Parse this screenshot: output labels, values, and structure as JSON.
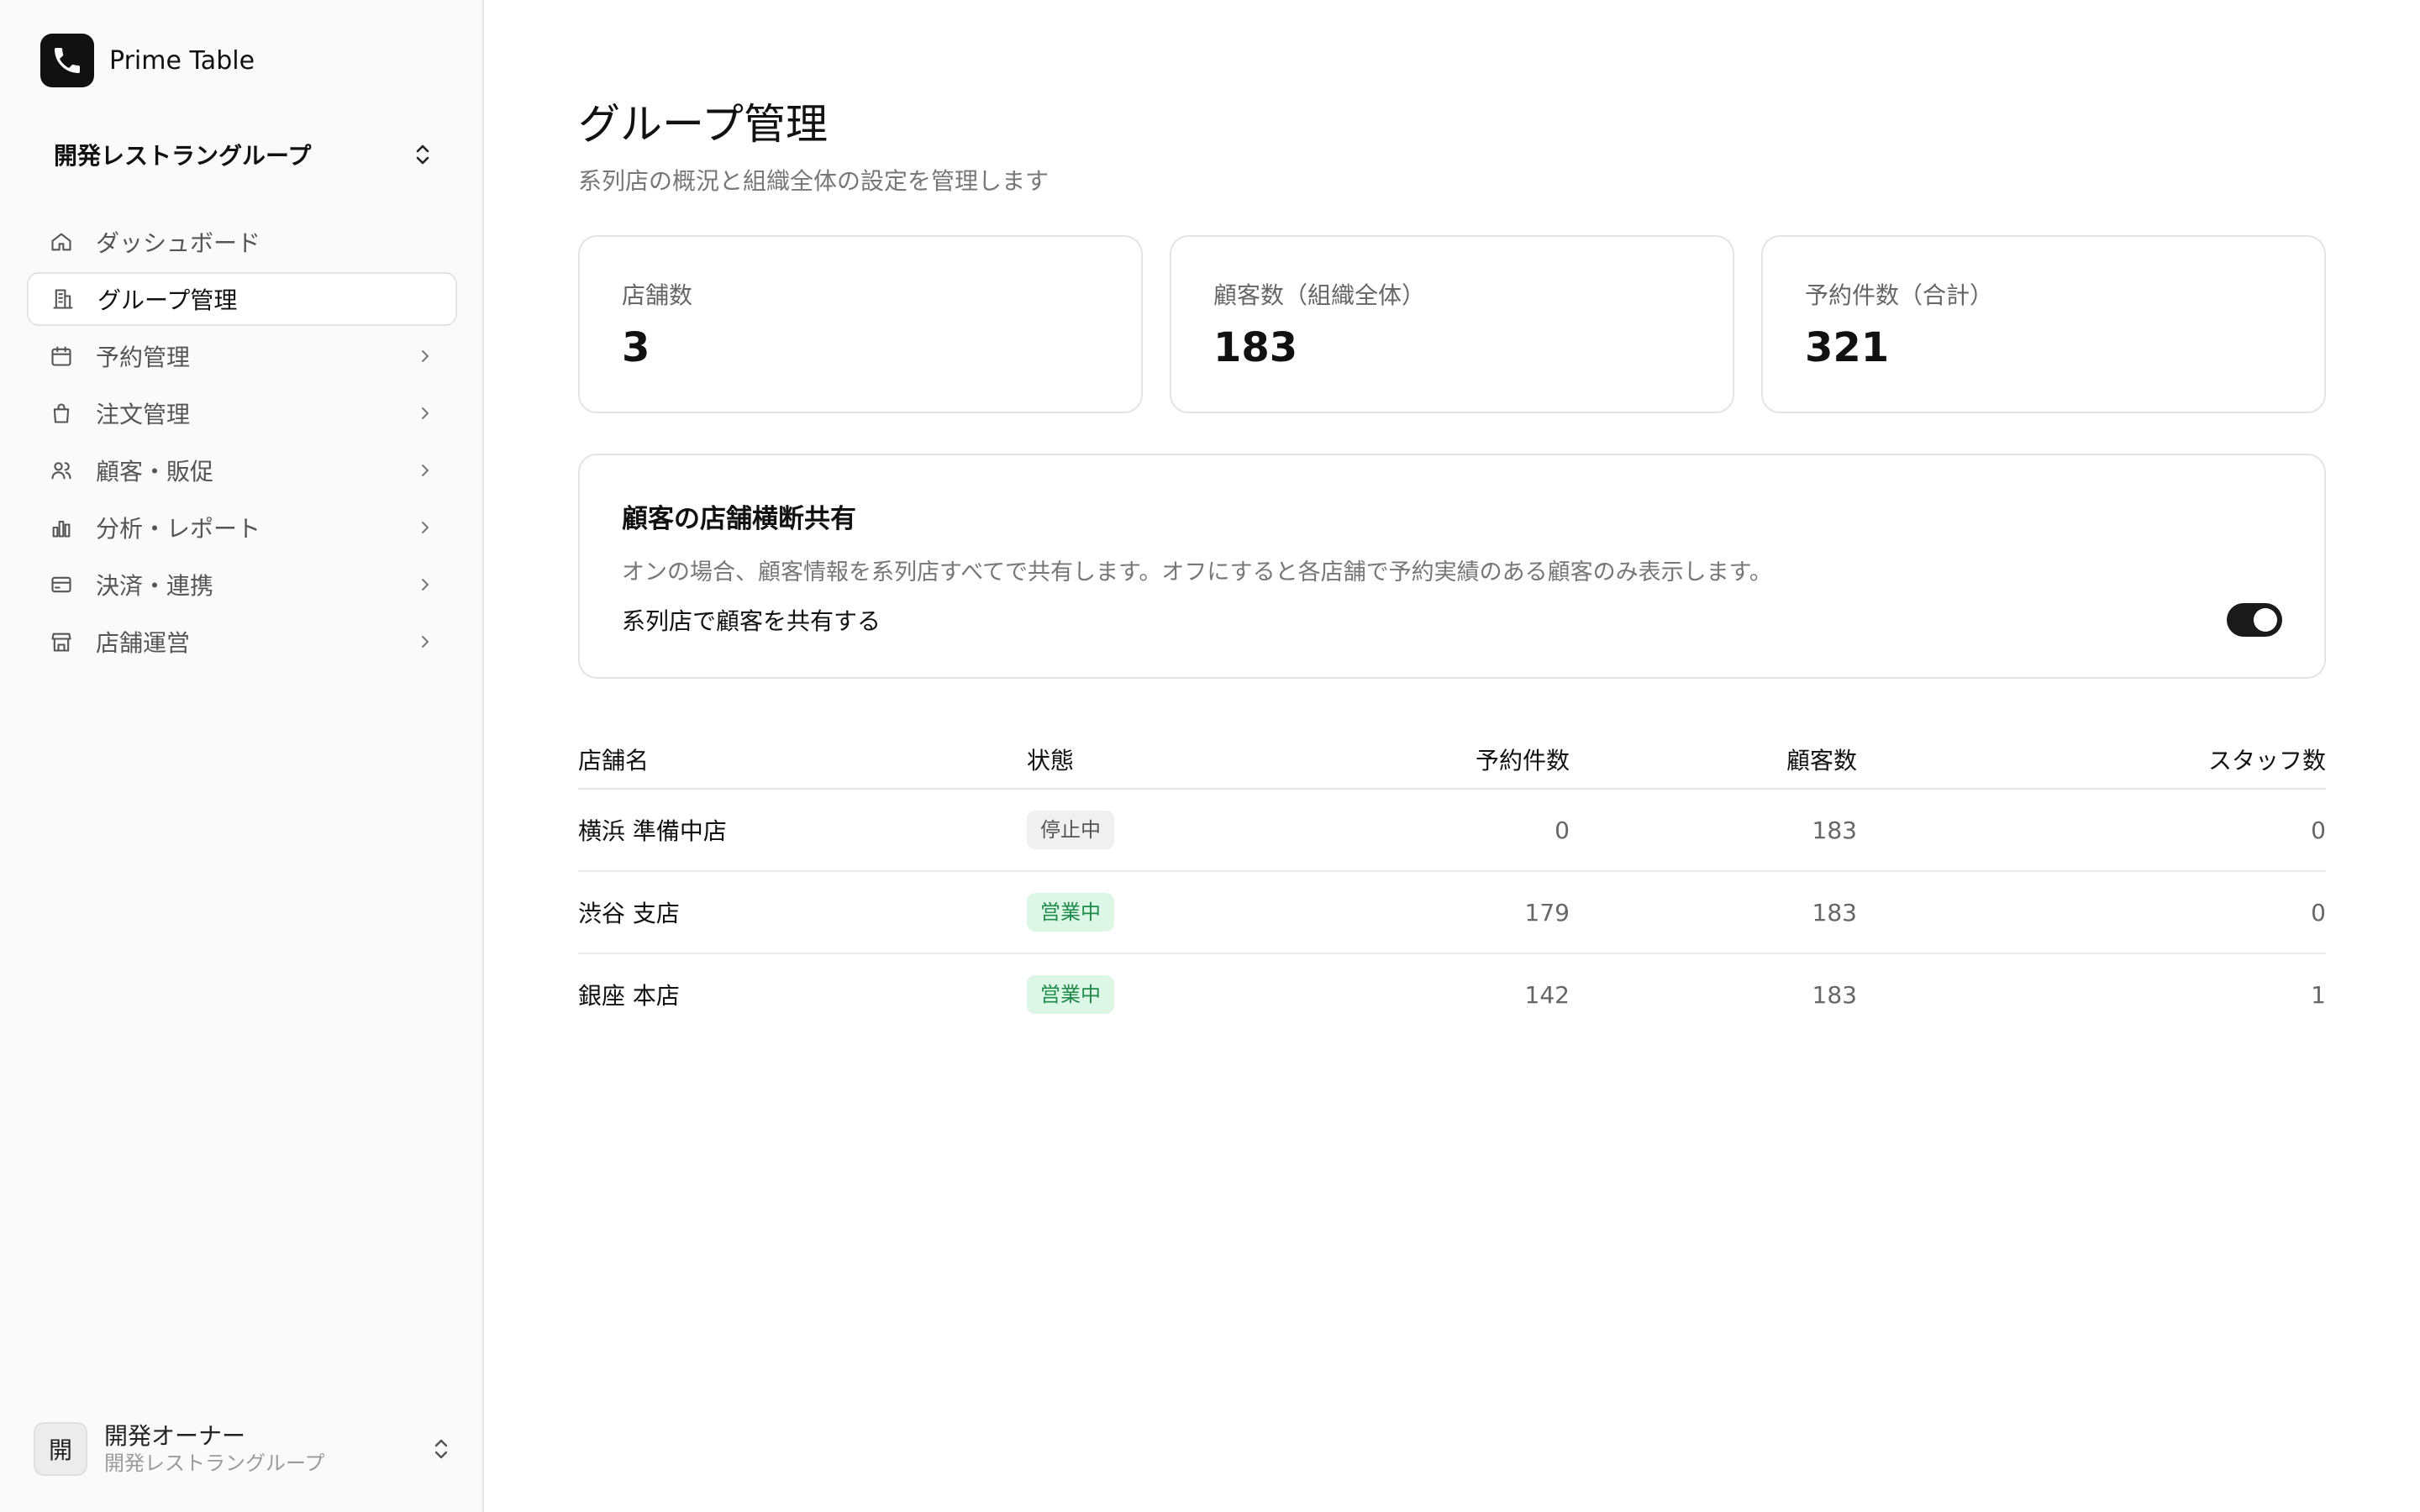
{
  "app": {
    "name": "Prime Table"
  },
  "org_switcher": {
    "name": "開発レストラングループ"
  },
  "nav": [
    {
      "label": "ダッシュボード",
      "icon": "home-icon",
      "active": false,
      "chevron": false
    },
    {
      "label": "グループ管理",
      "icon": "building-icon",
      "active": true,
      "chevron": false
    },
    {
      "label": "予約管理",
      "icon": "calendar-icon",
      "active": false,
      "chevron": true
    },
    {
      "label": "注文管理",
      "icon": "shopping-bag-icon",
      "active": false,
      "chevron": true
    },
    {
      "label": "顧客・販促",
      "icon": "users-icon",
      "active": false,
      "chevron": true
    },
    {
      "label": "分析・レポート",
      "icon": "bar-chart-icon",
      "active": false,
      "chevron": true
    },
    {
      "label": "決済・連携",
      "icon": "credit-card-icon",
      "active": false,
      "chevron": true
    },
    {
      "label": "店舗運営",
      "icon": "store-icon",
      "active": false,
      "chevron": true
    }
  ],
  "user": {
    "avatar": "開",
    "name": "開発オーナー",
    "org": "開発レストラングループ"
  },
  "page": {
    "title": "グループ管理",
    "subtitle": "系列店の概況と組織全体の設定を管理します"
  },
  "stats": [
    {
      "label": "店舗数",
      "value": "3"
    },
    {
      "label": "顧客数（組織全体）",
      "value": "183"
    },
    {
      "label": "予約件数（合計）",
      "value": "321"
    }
  ],
  "share": {
    "title": "顧客の店舗横断共有",
    "description": "オンの場合、顧客情報を系列店すべてで共有します。オフにすると各店舗で予約実績のある顧客のみ表示します。",
    "toggle_label": "系列店で顧客を共有する",
    "enabled": true
  },
  "table": {
    "headers": {
      "name": "店舗名",
      "status": "状態",
      "reservations": "予約件数",
      "customers": "顧客数",
      "staff": "スタッフ数"
    },
    "rows": [
      {
        "name": "横浜 準備中店",
        "status": "停止中",
        "status_type": "stopped",
        "reservations": "0",
        "customers": "183",
        "staff": "0"
      },
      {
        "name": "渋谷 支店",
        "status": "営業中",
        "status_type": "open",
        "reservations": "179",
        "customers": "183",
        "staff": "0"
      },
      {
        "name": "銀座 本店",
        "status": "営業中",
        "status_type": "open",
        "reservations": "142",
        "customers": "183",
        "staff": "1"
      }
    ]
  },
  "colors": {
    "accent": "#111111",
    "open_badge_bg": "#dcf7e6",
    "open_badge_text": "#1c8a48",
    "stopped_badge_bg": "#f0f0f0"
  }
}
